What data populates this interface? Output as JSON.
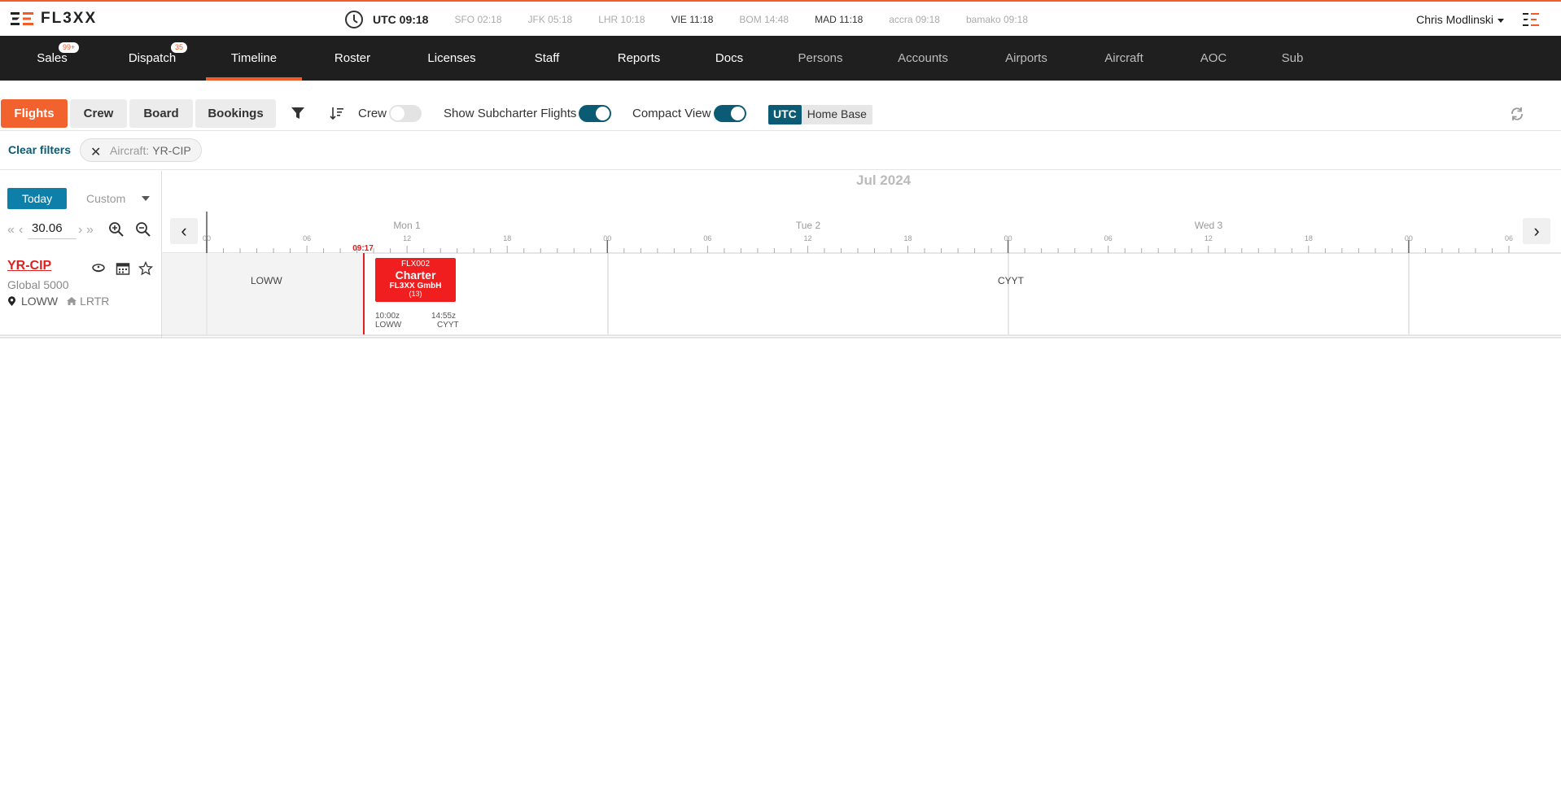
{
  "header": {
    "logo_text": "FL3XX",
    "utc_label": "UTC 09:18",
    "timezones": [
      {
        "label": "SFO 02:18",
        "emphasis": false
      },
      {
        "label": "JFK 05:18",
        "emphasis": false
      },
      {
        "label": "LHR 10:18",
        "emphasis": false
      },
      {
        "label": "VIE 11:18",
        "emphasis": true
      },
      {
        "label": "BOM 14:48",
        "emphasis": false
      },
      {
        "label": "MAD 11:18",
        "emphasis": true
      },
      {
        "label": "accra 09:18",
        "emphasis": false
      },
      {
        "label": "bamako 09:18",
        "emphasis": false
      }
    ],
    "user_name": "Chris Modlinski"
  },
  "nav": {
    "items": [
      {
        "label": "Sales",
        "badge": "99+"
      },
      {
        "label": "Dispatch",
        "badge": "35"
      },
      {
        "label": "Timeline",
        "active": true
      },
      {
        "label": "Roster"
      },
      {
        "label": "Licenses"
      },
      {
        "label": "Staff"
      },
      {
        "label": "Reports"
      },
      {
        "label": "Docs"
      },
      {
        "label": "Persons",
        "dim": true
      },
      {
        "label": "Accounts",
        "dim": true
      },
      {
        "label": "Airports",
        "dim": true
      },
      {
        "label": "Aircraft",
        "dim": true
      },
      {
        "label": "AOC",
        "dim": true
      },
      {
        "label": "Sub",
        "dim": true
      }
    ]
  },
  "toolbar": {
    "tabs": [
      "Flights",
      "Crew",
      "Board",
      "Bookings"
    ],
    "active_tab": "Flights",
    "crew_toggle_label": "Crew",
    "crew_toggle_on": false,
    "subcharter_label": "Show Subcharter Flights",
    "subcharter_on": true,
    "compact_label": "Compact View",
    "compact_on": true,
    "utc_label": "UTC",
    "home_base_label": "Home Base"
  },
  "filters": {
    "clear_label": "Clear filters",
    "chip_label": "Aircraft:",
    "chip_value": "YR-CIP"
  },
  "controls": {
    "today_label": "Today",
    "range_select": "Custom",
    "date_value": "30.06"
  },
  "timeline": {
    "month_label": "Jul 2024",
    "day_labels": [
      "Mon 1",
      "Tue 2",
      "Wed 3"
    ],
    "hour_ticks": [
      "00",
      "06",
      "12",
      "18"
    ],
    "now_label": "09:17"
  },
  "rows": [
    {
      "registration": "YR-CIP",
      "aircraft_type": "Global 5000",
      "location": "LOWW",
      "home_base": "LRTR",
      "segments": [
        {
          "airport": "LOWW"
        },
        {
          "airport": "CYYT"
        }
      ],
      "flight": {
        "number": "FLX002",
        "type": "Charter",
        "customer": "FL3XX GmbH",
        "pax": "(13)",
        "dep_time": "10:00z",
        "dep_airport": "LOWW",
        "arr_time": "14:55z",
        "arr_airport": "CYYT"
      }
    }
  ],
  "colors": {
    "brand_orange": "#f25c2a",
    "nav_bg": "#1f1f1f",
    "accent_teal": "#0a5b73",
    "flight_red": "#f01e1e"
  }
}
